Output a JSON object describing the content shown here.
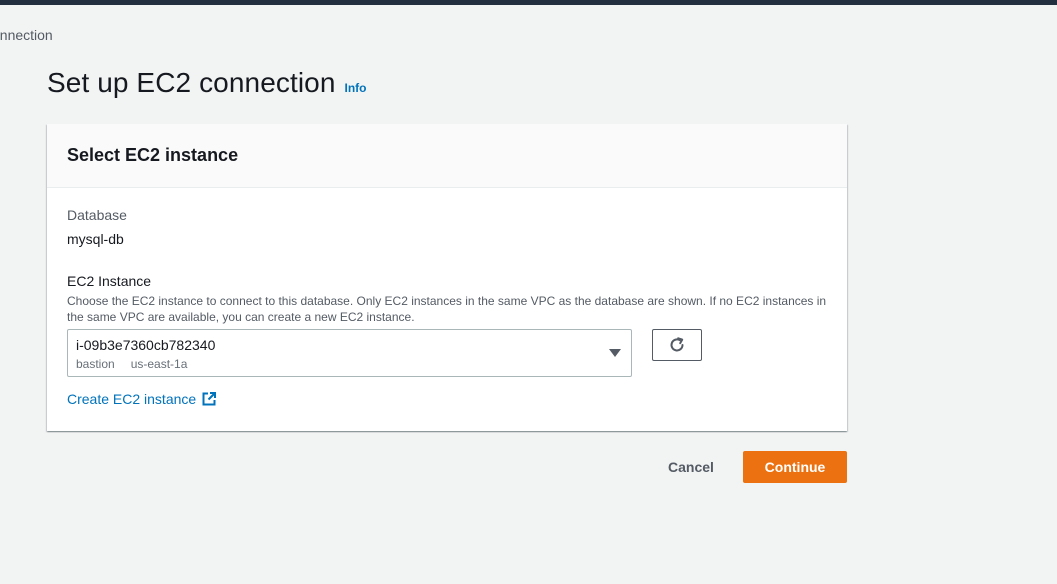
{
  "breadcrumb": {
    "current": "onnection"
  },
  "page": {
    "title": "Set up EC2 connection",
    "info_label": "Info"
  },
  "panel": {
    "title": "Select EC2 instance",
    "database_label": "Database",
    "database_value": "mysql-db",
    "ec2_label": "EC2 Instance",
    "ec2_description": "Choose the EC2 instance to connect to this database. Only EC2 instances in the same VPC as the database are shown. If no EC2 instances in the same VPC are available, you can create a new EC2 instance.",
    "select": {
      "selected_value": "i-09b3e7360cb782340",
      "tags": [
        "bastion",
        "us-east-1a"
      ]
    },
    "create_link": "Create EC2 instance"
  },
  "actions": {
    "cancel_label": "Cancel",
    "continue_label": "Continue"
  },
  "colors": {
    "primary": "#ec7211",
    "link": "#0073bb",
    "background": "#f2f3f3",
    "header": "#232f3e"
  },
  "icons": [
    "caret-down-icon",
    "refresh-icon",
    "external-link-icon"
  ]
}
